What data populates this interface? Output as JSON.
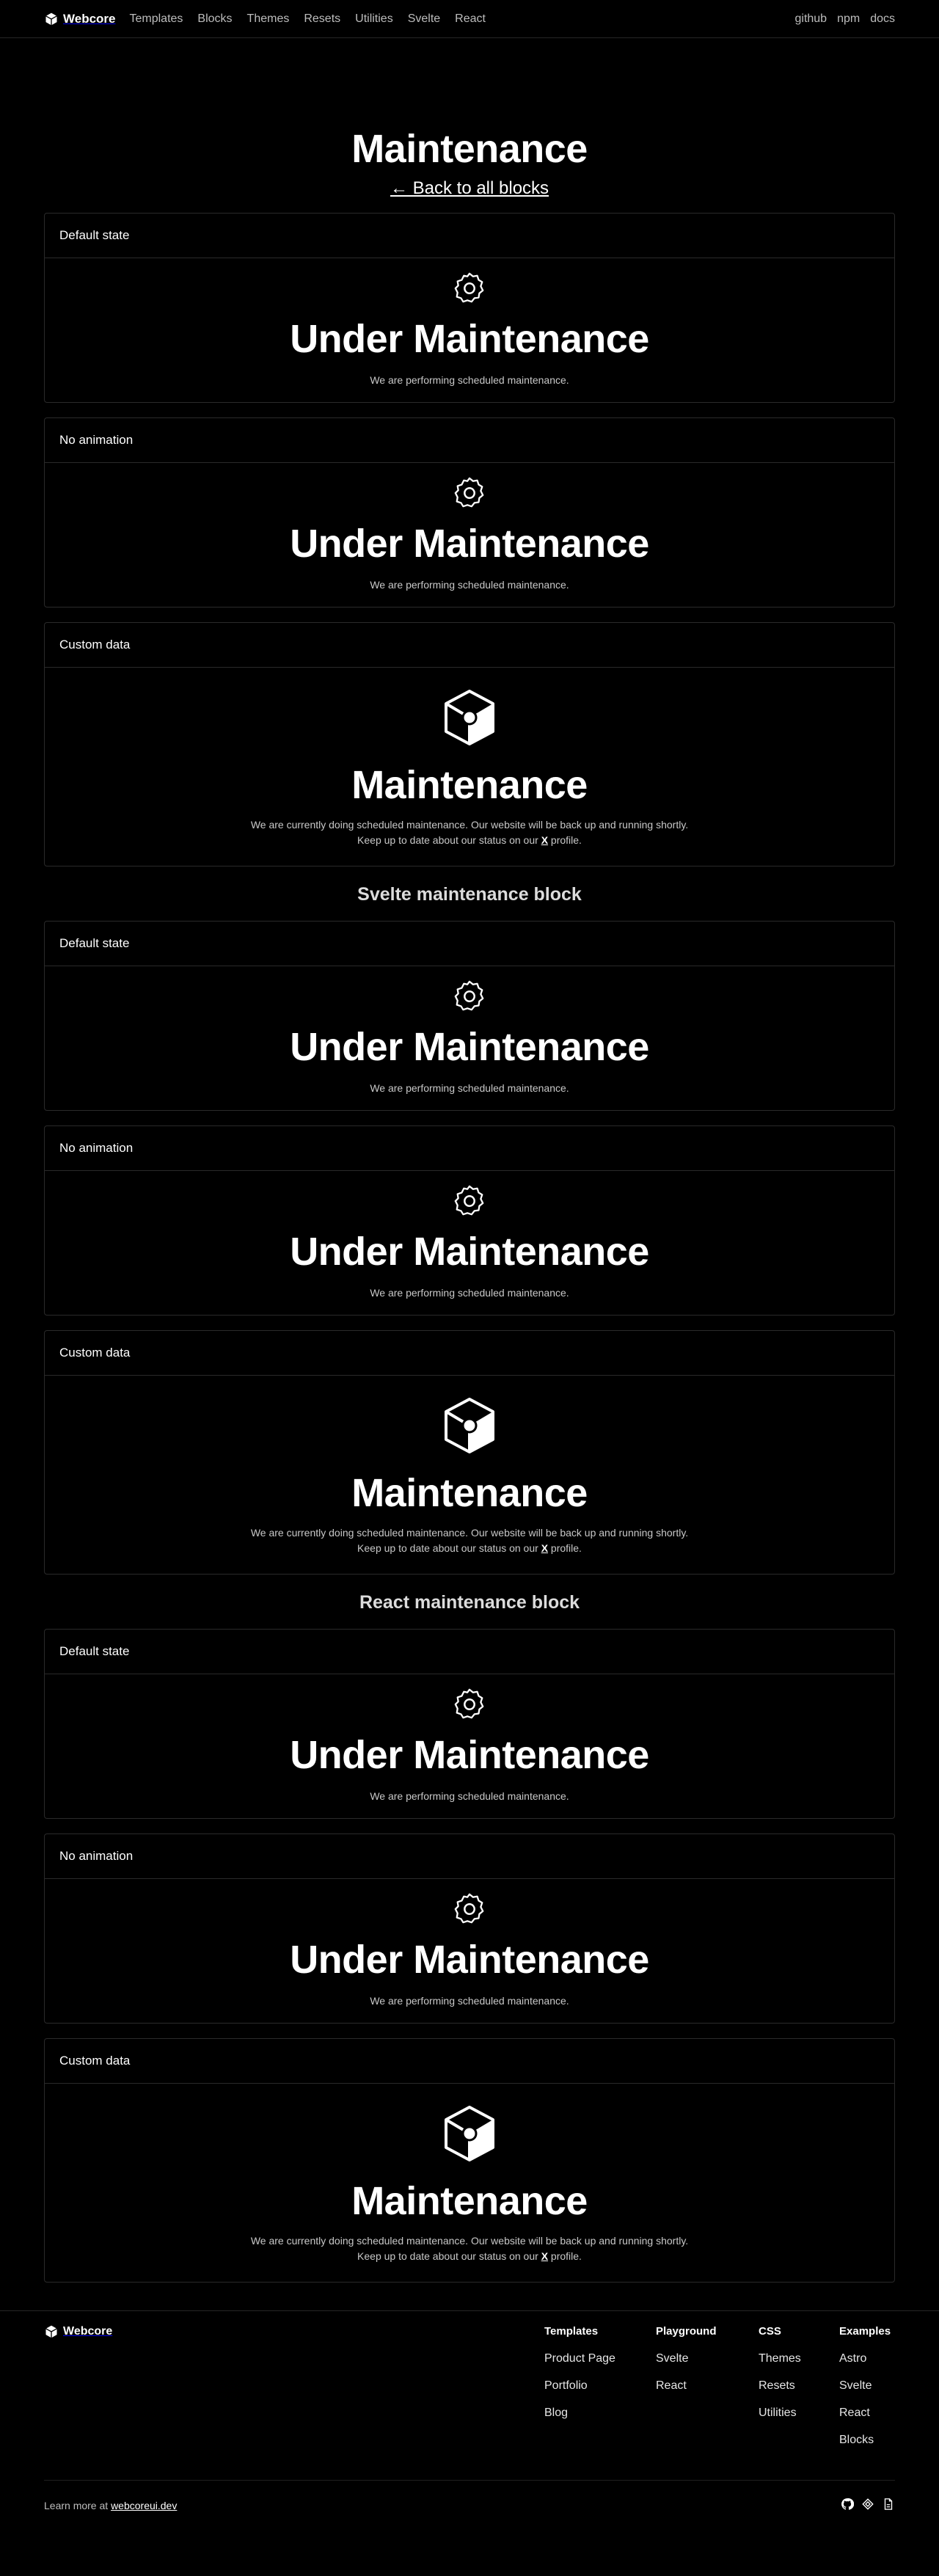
{
  "header": {
    "logo_text": "Webcore",
    "nav": [
      "Templates",
      "Blocks",
      "Themes",
      "Resets",
      "Utilities",
      "Svelte",
      "React"
    ],
    "right_links": [
      "github",
      "npm",
      "docs"
    ]
  },
  "page": {
    "title": "Maintenance",
    "back_link": "← Back to all blocks"
  },
  "sections": [
    {
      "heading": "",
      "cards": [
        {
          "label": "Default state",
          "title": "Under Maintenance",
          "text": "We are performing scheduled maintenance."
        },
        {
          "label": "No animation",
          "title": "Under Maintenance",
          "text": "We are performing scheduled maintenance."
        },
        {
          "label": "Custom data",
          "title": "Maintenance",
          "text1": "We are currently doing scheduled maintenance. Our website will be back up and running shortly.",
          "text2_pre": "Keep up to date about our status on our ",
          "text2_link": "X",
          "text2_post": " profile."
        }
      ]
    },
    {
      "heading": "Svelte maintenance block",
      "cards": [
        {
          "label": "Default state",
          "title": "Under Maintenance",
          "text": "We are performing scheduled maintenance."
        },
        {
          "label": "No animation",
          "title": "Under Maintenance",
          "text": "We are performing scheduled maintenance."
        },
        {
          "label": "Custom data",
          "title": "Maintenance",
          "text1": "We are currently doing scheduled maintenance. Our website will be back up and running shortly.",
          "text2_pre": "Keep up to date about our status on our ",
          "text2_link": "X",
          "text2_post": " profile."
        }
      ]
    },
    {
      "heading": "React maintenance block",
      "cards": [
        {
          "label": "Default state",
          "title": "Under Maintenance",
          "text": "We are performing scheduled maintenance."
        },
        {
          "label": "No animation",
          "title": "Under Maintenance",
          "text": "We are performing scheduled maintenance."
        },
        {
          "label": "Custom data",
          "title": "Maintenance",
          "text1": "We are currently doing scheduled maintenance. Our website will be back up and running shortly.",
          "text2_pre": "Keep up to date about our status on our ",
          "text2_link": "X",
          "text2_post": " profile."
        }
      ]
    }
  ],
  "footer": {
    "logo_text": "Webcore",
    "columns": [
      {
        "title": "Templates",
        "links": [
          "Product Page",
          "Portfolio",
          "Blog"
        ]
      },
      {
        "title": "Playground",
        "links": [
          "Svelte",
          "React"
        ]
      },
      {
        "title": "CSS",
        "links": [
          "Themes",
          "Resets",
          "Utilities"
        ]
      },
      {
        "title": "Examples",
        "links": [
          "Astro",
          "Svelte",
          "React",
          "Blocks"
        ]
      }
    ],
    "learn_pre": "Learn more at ",
    "learn_link": "webcoreui.dev",
    "icons": [
      "github-icon",
      "figma-icon",
      "file-icon"
    ]
  }
}
